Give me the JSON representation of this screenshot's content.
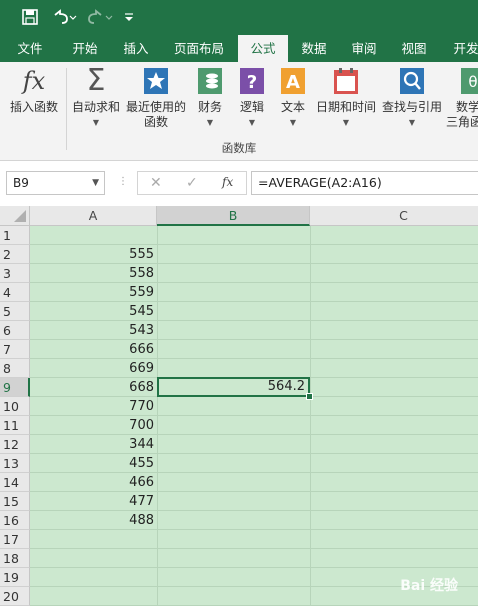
{
  "quick_access": {
    "save_icon": "save-icon",
    "undo_icon": "undo-icon",
    "redo_icon": "redo-icon",
    "customize_icon": "customize-icon"
  },
  "tabs": [
    {
      "label": "文件",
      "active": false
    },
    {
      "label": "开始",
      "active": false
    },
    {
      "label": "插入",
      "active": false
    },
    {
      "label": "页面布局",
      "active": false
    },
    {
      "label": "公式",
      "active": true
    },
    {
      "label": "数据",
      "active": false
    },
    {
      "label": "审阅",
      "active": false
    },
    {
      "label": "视图",
      "active": false
    },
    {
      "label": "开发",
      "active": false
    }
  ],
  "ribbon": {
    "insert_function": "插入函数",
    "autosum": "自动求和",
    "recent": "最近使用的",
    "recent2": "函数",
    "financial": "财务",
    "logical": "逻辑",
    "text": "文本",
    "datetime": "日期和时间",
    "lookup": "查找与引用",
    "math": "数学",
    "math2": "三角函",
    "group_label": "函数库"
  },
  "formula_bar": {
    "name_box": "B9",
    "fx": "fx",
    "formula": "=AVERAGE(A2:A16)"
  },
  "columns": [
    "A",
    "B",
    "C"
  ],
  "rows": [
    "1",
    "2",
    "3",
    "4",
    "5",
    "6",
    "7",
    "8",
    "9",
    "10",
    "11",
    "12",
    "13",
    "14",
    "15",
    "16",
    "17",
    "18",
    "19",
    "20"
  ],
  "column_a_values": [
    "",
    "555",
    "558",
    "559",
    "545",
    "543",
    "666",
    "669",
    "668",
    "770",
    "700",
    "344",
    "455",
    "466",
    "477",
    "488",
    "",
    "",
    "",
    ""
  ],
  "active_cell": {
    "ref": "B9",
    "value": "564.2"
  },
  "colors": {
    "accent": "#217346",
    "sheet_bg": "#cce8cf"
  },
  "watermark": "Bai 经验"
}
